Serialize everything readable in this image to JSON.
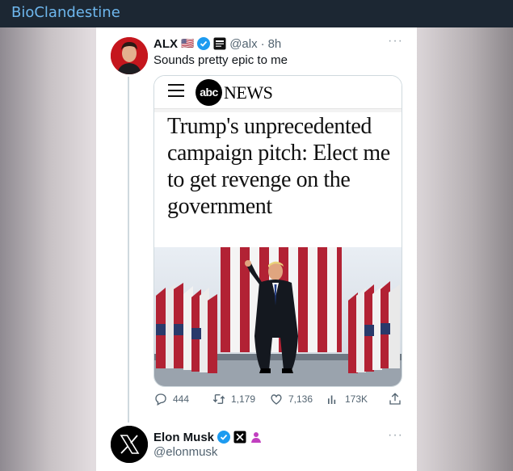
{
  "app": {
    "channel_title": "BioClandestine"
  },
  "tweet": {
    "display_name": "ALX",
    "flag": "🇺🇸",
    "handle": "@alx",
    "separator": "·",
    "time": "8h",
    "text": "Sounds pretty epic to me",
    "more": "···",
    "embed": {
      "brand_badge": "abc",
      "brand_name": "NEWS",
      "headline": "Trump's unprecedented campaign pitch: Elect me to get revenge on the government"
    },
    "stats": {
      "replies": "444",
      "retweets": "1,179",
      "likes": "7,136",
      "views": "173K"
    }
  },
  "reply": {
    "display_name": "Elon Musk",
    "handle": "@elonmusk",
    "more": "···"
  },
  "colors": {
    "topbar_bg": "#1c2733",
    "topbar_text": "#6eb7ee",
    "verified_blue": "#1d9bf0",
    "text_primary": "#0f1419",
    "text_secondary": "#536471"
  }
}
